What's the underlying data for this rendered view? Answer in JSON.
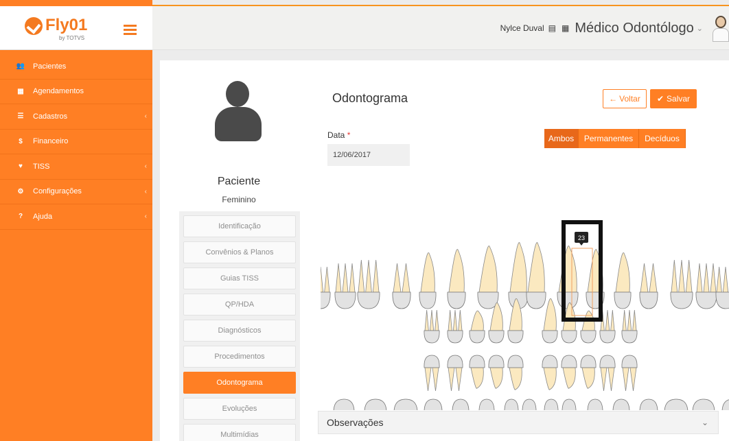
{
  "brand": {
    "name": "Fly01",
    "sub": "by TOTVS"
  },
  "sidebar": {
    "items": [
      {
        "label": "Pacientes",
        "icon": "users-icon",
        "glyph": "👥",
        "has_sub": false
      },
      {
        "label": "Agendamentos",
        "icon": "calendar-icon",
        "glyph": "▦",
        "has_sub": false
      },
      {
        "label": "Cadastros",
        "icon": "list-icon",
        "glyph": "☰",
        "has_sub": true
      },
      {
        "label": "Financeiro",
        "icon": "dollar-icon",
        "glyph": "$",
        "has_sub": false
      },
      {
        "label": "TISS",
        "icon": "heart-pulse-icon",
        "glyph": "♥",
        "has_sub": true
      },
      {
        "label": "Configurações",
        "icon": "gear-icon",
        "glyph": "⚙",
        "has_sub": true
      },
      {
        "label": "Ajuda",
        "icon": "question-icon",
        "glyph": "?",
        "has_sub": true
      }
    ]
  },
  "header": {
    "user_name": "Nylce Duval",
    "role": "Médico Odontólogo"
  },
  "patient": {
    "label": "Paciente",
    "sex": "Feminino",
    "tabs": [
      "Identificação",
      "Convênios & Planos",
      "Guias TISS",
      "QP/HDA",
      "Diagnósticos",
      "Procedimentos",
      "Odontograma",
      "Evoluções",
      "Multimídias"
    ],
    "active_tab": "Odontograma"
  },
  "main": {
    "title": "Odontograma",
    "voltar_label": "Voltar",
    "salvar_label": "Salvar",
    "data_label": "Data",
    "data_value": "12/06/2017",
    "segments": [
      "Ambos",
      "Permanentes",
      "Decíduos"
    ],
    "active_segment": "Ambos",
    "tooth_tooltip": "23",
    "observacoes_label": "Observações"
  },
  "colors": {
    "accent": "#ff7f24",
    "tooth_crown": "#e2e2e2",
    "tooth_root": "#fbe9c0"
  }
}
